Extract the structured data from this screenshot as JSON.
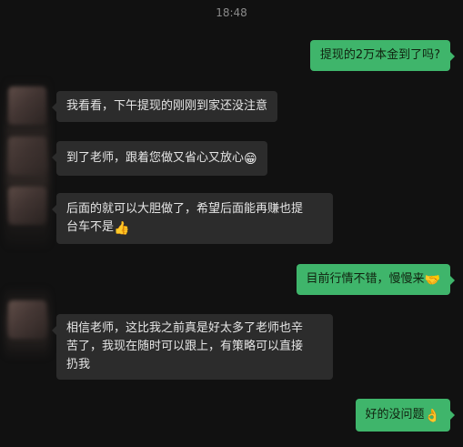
{
  "timestamp": "18:48",
  "messages": [
    {
      "side": "out",
      "text": "提现的2万本金到了吗?"
    },
    {
      "side": "in",
      "text": "我看看，下午提现的刚刚到家还没注意"
    },
    {
      "side": "in",
      "text": "到了老师，跟着您做又省心又放心",
      "emoji": "😁"
    },
    {
      "side": "in",
      "line1": "后面的就可以大胆做了，希望后面能再赚也提",
      "line2": "台车不是",
      "emoji": "👍"
    },
    {
      "side": "out",
      "text": "目前行情不错，慢慢来",
      "emoji": "🤝"
    },
    {
      "side": "in",
      "line1": "相信老师，这比我之前真是好太多了老师也辛",
      "line2": "苦了，我现在随时可以跟上，有策略可以直接",
      "line3": "扔我"
    },
    {
      "side": "out",
      "text": "好的没问题",
      "emoji": "👌"
    }
  ]
}
